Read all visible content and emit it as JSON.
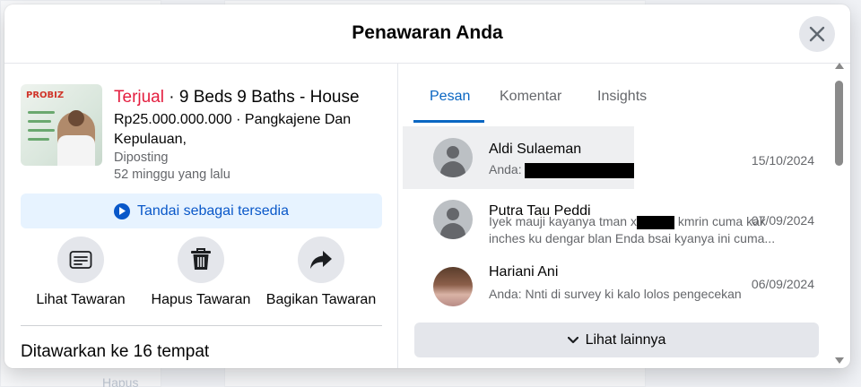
{
  "modal": {
    "title": "Penawaran Anda"
  },
  "listing": {
    "thumbnail_brand": "PROBIZ",
    "status": "Terjual",
    "title_rest": " · 9 Beds 9 Baths - House",
    "price_location": "Rp25.000.000.000 · Pangkajene Dan Kepulauan,",
    "posted_label": "Diposting",
    "posted_time": "52 minggu yang lalu"
  },
  "mark_available_label": "Tandai sebagai tersedia",
  "actions": [
    {
      "label": "Lihat Tawaran",
      "icon": "listing-icon"
    },
    {
      "label": "Hapus Tawaran",
      "icon": "trash-icon"
    },
    {
      "label": "Bagikan Tawaran",
      "icon": "share-icon"
    }
  ],
  "offered_heading": "Ditawarkan ke 16 tempat",
  "background_label": "Hapus",
  "tabs": [
    {
      "label": "Pesan",
      "active": true
    },
    {
      "label": "Komentar",
      "active": false
    },
    {
      "label": "Insights",
      "active": false
    }
  ],
  "conversations": [
    {
      "name": "Aldi Sulaeman",
      "message": "Anda: ",
      "message_line2": "",
      "date": "15/10/2024",
      "avatar": "default-avatar"
    },
    {
      "name": "Putra Tau Peddi",
      "message": "Iyek mauji kayanya tman x",
      "message_after": " kmrin cuma kak",
      "message_line2": "inches ku dengar blan Enda bsai kyanya ini cuma...",
      "date": "07/09/2024",
      "avatar": "default-avatar"
    },
    {
      "name": "Hariani Ani",
      "message": "Anda: Nnti di survey ki kalo lolos pengecekan",
      "message_line2": "",
      "date": "06/09/2024",
      "avatar": "photo-avatar"
    }
  ],
  "see_more_label": "Lihat lainnya",
  "colors": {
    "accent": "#0a66c2",
    "status_sold": "#e41e3f",
    "mark_available_bg": "#e7f3ff"
  }
}
